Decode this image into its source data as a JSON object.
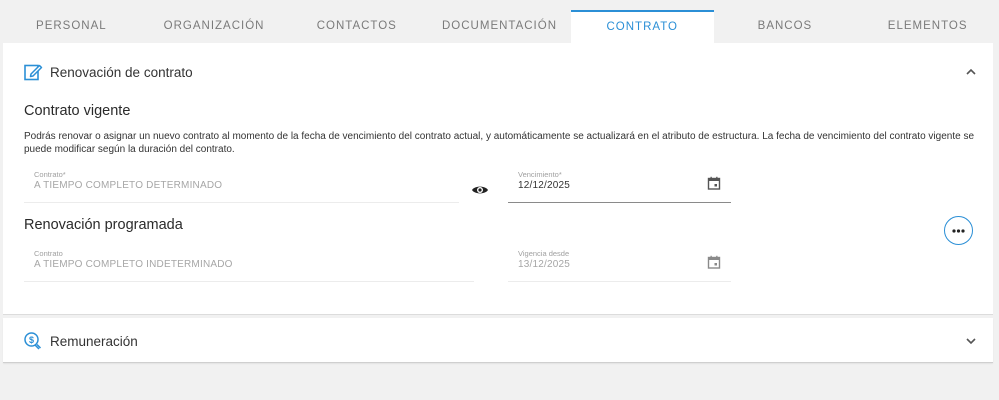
{
  "tabs": [
    {
      "label": "PERSONAL"
    },
    {
      "label": "ORGANIZACIÓN"
    },
    {
      "label": "CONTACTOS"
    },
    {
      "label": "DOCUMENTACIÓN"
    },
    {
      "label": "CONTRATO"
    },
    {
      "label": "BANCOS"
    },
    {
      "label": "ELEMENTOS"
    }
  ],
  "active_tab": "CONTRATO",
  "renewal_section": {
    "title": "Renovación de contrato",
    "current": {
      "heading": "Contrato vigente",
      "description": "Podrás renovar o asignar un nuevo contrato al momento de la fecha de vencimiento del contrato actual, y automáticamente se actualizará en el atributo de estructura. La fecha de vencimiento del contrato vigente se puede modificar según la duración del contrato.",
      "contract_label": "Contrato*",
      "contract_value": "A TIEMPO COMPLETO DETERMINADO",
      "expiry_label": "Vencimiento*",
      "expiry_value": "12/12/2025"
    },
    "scheduled": {
      "heading": "Renovación programada",
      "contract_label": "Contrato",
      "contract_value": "A TIEMPO COMPLETO INDETERMINADO",
      "valid_from_label": "Vigencia desde",
      "valid_from_value": "13/12/2025"
    }
  },
  "remuneration_section": {
    "title": "Remuneración"
  },
  "colors": {
    "accent": "#2b8fd6",
    "background": "#f1f1f1"
  }
}
